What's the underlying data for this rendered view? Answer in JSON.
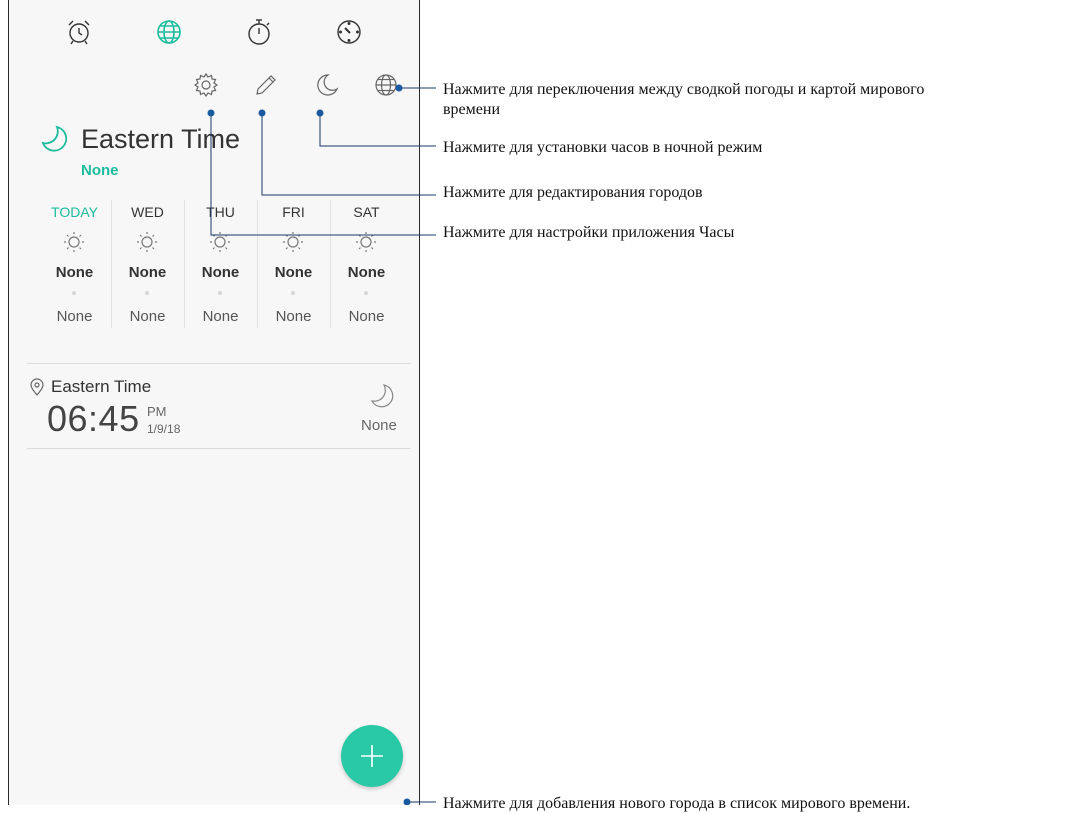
{
  "tabs": [
    {
      "name": "alarm-clock-icon"
    },
    {
      "name": "world-clock-icon",
      "active": true
    },
    {
      "name": "stopwatch-icon"
    },
    {
      "name": "timer-icon"
    }
  ],
  "toolbar": {
    "icons": [
      "settings-gear-icon",
      "edit-pencil-icon",
      "night-mode-moon-icon",
      "globe-icon"
    ]
  },
  "city": {
    "title": "Eastern Time",
    "subtitle": "None"
  },
  "forecast": [
    {
      "day": "TODAY",
      "high": "None",
      "low": "None"
    },
    {
      "day": "WED",
      "high": "None",
      "low": "None"
    },
    {
      "day": "THU",
      "high": "None",
      "low": "None"
    },
    {
      "day": "FRI",
      "high": "None",
      "low": "None"
    },
    {
      "day": "SAT",
      "high": "None",
      "low": "None"
    }
  ],
  "clock_entry": {
    "name": "Eastern Time",
    "time": "06:45",
    "ampm": "PM",
    "date": "1/9/18",
    "weather": "None"
  },
  "callouts": {
    "globe": "Нажмите для переключения между сводкой погоды и  картой мирового",
    "globe_line2": "времени",
    "night": "Нажмите для установки часов в ночной режим",
    "edit": "Нажмите для редактирования городов",
    "settings": "Нажмите для настройки приложения Часы",
    "add": "Нажмите для добавления нового города в список мирового времени."
  },
  "colors": {
    "accent": "#1abc9c",
    "fab": "#29c9a8",
    "callout_line": "#1a5aa0"
  }
}
